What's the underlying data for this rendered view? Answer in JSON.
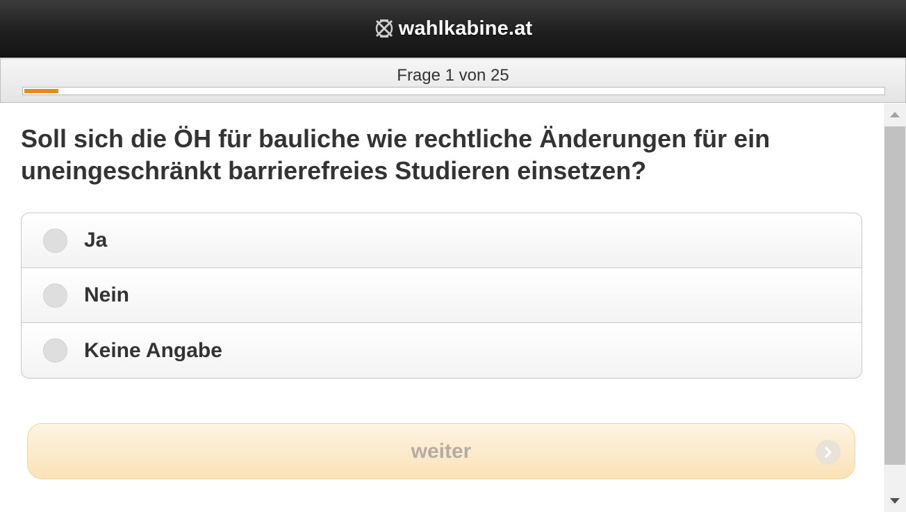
{
  "header": {
    "title": "wahlkabine.at",
    "logo_icon": "ballot-cross-icon"
  },
  "progress": {
    "label": "Frage 1 von 25",
    "current": 1,
    "total": 25,
    "accent_color": "#e8891b"
  },
  "question": {
    "text": "Soll sich die ÖH für bauliche wie rechtliche Änderungen für ein uneingeschränkt barrierefreies Studieren einsetzen?"
  },
  "answers": [
    {
      "label": "Ja",
      "selected": false
    },
    {
      "label": "Nein",
      "selected": false
    },
    {
      "label": "Keine Angabe",
      "selected": false
    }
  ],
  "next_button": {
    "label": "weiter",
    "enabled": false,
    "icon": "chevron-right-icon"
  },
  "scrollbar": {
    "up_icon": "scroll-up-arrow-icon",
    "down_icon": "scroll-down-arrow-icon"
  }
}
